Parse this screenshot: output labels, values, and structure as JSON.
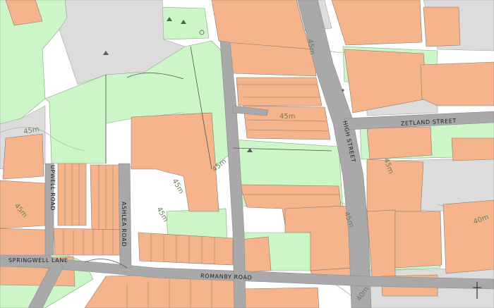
{
  "colors": {
    "background": "#ffffff",
    "road": "#a9a9a9",
    "road_edge": "#8c8c8c",
    "building": "#f6b48d",
    "building_edge": "#8a7a70",
    "green": "#ccf5c8",
    "green_edge": "#8aa882",
    "grey_area": "#dcdcdc",
    "contour": "#a6b89a",
    "outline": "#555555"
  },
  "roads": {
    "high_street": "HIGH STREET",
    "zetland_street": "ZETLAND STREET",
    "romanby_road": "ROMANBY ROAD",
    "ashlea_road": "ASHLEA ROAD",
    "springwell_lane": "SPRINGWELL LANE",
    "upwell_road": "UPWELL ROAD"
  },
  "contours": {
    "c1": "45m",
    "c2": "45m",
    "c3": "45m",
    "c4": "45m",
    "c5": "45m",
    "c6": "45m",
    "c7": "40m",
    "c8": "45m",
    "c9": "45m",
    "c10": "45m",
    "c11": "40m"
  }
}
